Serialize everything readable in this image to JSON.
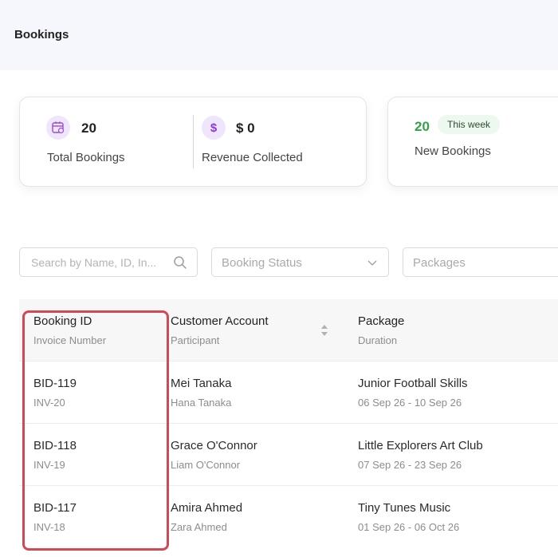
{
  "header": {
    "title": "Bookings"
  },
  "stats": {
    "total_bookings": {
      "value": "20",
      "label": "Total Bookings",
      "icon": "calendar-icon"
    },
    "revenue": {
      "value": "$ 0",
      "label": "Revenue Collected",
      "icon": "dollar-icon"
    },
    "new_bookings": {
      "value": "20",
      "badge": "This week",
      "label": "New Bookings"
    }
  },
  "filters": {
    "search_placeholder": "Search by Name, ID, In...",
    "status_label": "Booking Status",
    "packages_label": "Packages"
  },
  "table": {
    "columns": [
      {
        "title": "Booking ID",
        "subtitle": "Invoice Number"
      },
      {
        "title": "Customer Account",
        "subtitle": "Participant"
      },
      {
        "title": "Package",
        "subtitle": "Duration"
      }
    ],
    "rows": [
      {
        "booking_id": "BID-119",
        "invoice": "INV-20",
        "customer": "Mei Tanaka",
        "participant": "Hana Tanaka",
        "package": "Junior Football Skills",
        "duration": "06 Sep 26 - 10 Sep 26"
      },
      {
        "booking_id": "BID-118",
        "invoice": "INV-19",
        "customer": "Grace O'Connor",
        "participant": "Liam O'Connor",
        "package": "Little Explorers Art Club",
        "duration": "07 Sep 26 - 23 Sep 26"
      },
      {
        "booking_id": "BID-117",
        "invoice": "INV-18",
        "customer": "Amira Ahmed",
        "participant": "Zara Ahmed",
        "package": "Tiny Tunes Music",
        "duration": "01 Sep 26 - 06 Oct 26"
      }
    ]
  },
  "colors": {
    "accent_purple": "#8a3ad6",
    "positive_green": "#33a24a",
    "highlight_red": "#cf4a55",
    "header_bg": "#f6f6fd"
  }
}
